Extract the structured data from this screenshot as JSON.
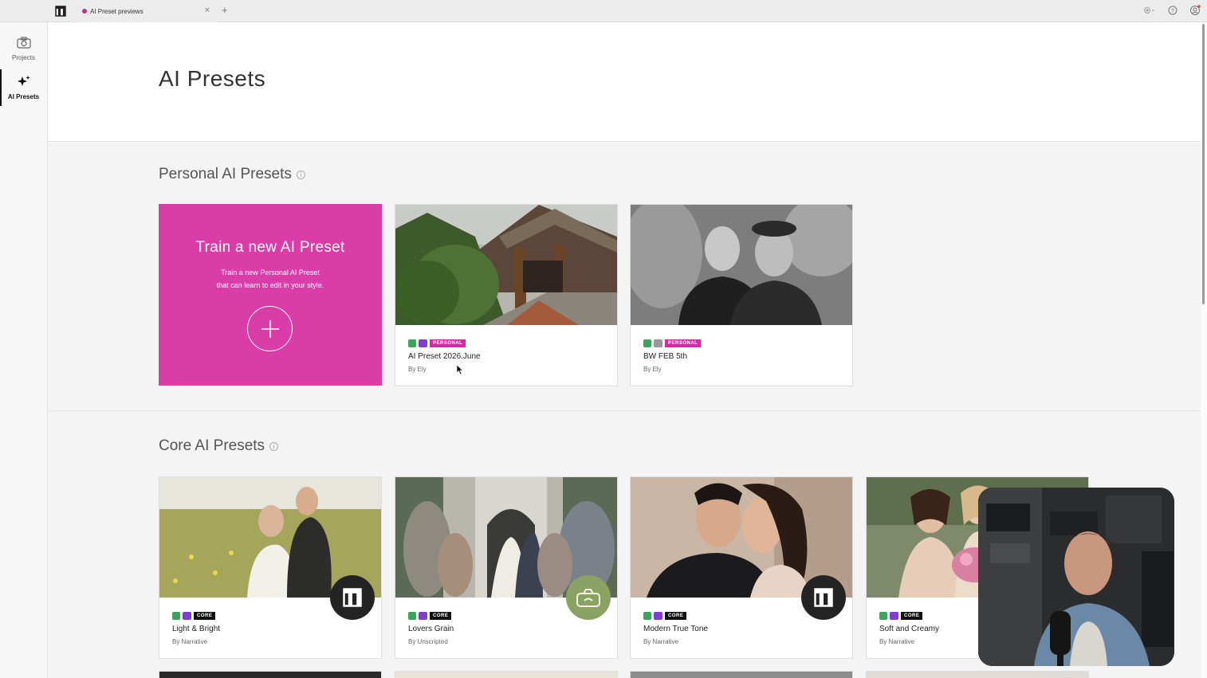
{
  "window": {
    "tab_label": "AI Preset previews",
    "tab_close": "×",
    "tab_add": "+"
  },
  "sidebar": {
    "items": [
      {
        "label": "Projects",
        "icon": "camera-icon"
      },
      {
        "label": "AI Presets",
        "icon": "sparkle-icon"
      }
    ]
  },
  "page": {
    "title": "AI Presets"
  },
  "personal_section": {
    "title": "Personal AI Presets",
    "train_card": {
      "title": "Train a new AI Preset",
      "subtitle_line1": "Train a new Personal AI Preset",
      "subtitle_line2": "that can learn to edit in your style."
    },
    "cards": [
      {
        "name": "AI Preset 2026.June",
        "by": "By Ely",
        "badge": "PERSONAL"
      },
      {
        "name": "BW FEB 5th",
        "by": "By Ely",
        "badge": "PERSONAL"
      }
    ]
  },
  "core_section": {
    "title": "Core AI Presets",
    "cards": [
      {
        "name": "Light & Bright",
        "by": "By Narrative",
        "badge": "CORE",
        "brand_icon": "narrative-logo-icon"
      },
      {
        "name": "Lovers Grain",
        "by": "By Unscripted",
        "badge": "CORE",
        "brand_icon": "unscripted-logo-icon"
      },
      {
        "name": "Modern True Tone",
        "by": "By Narrative",
        "badge": "CORE",
        "brand_icon": "narrative-logo-icon"
      },
      {
        "name": "Soft and Creamy",
        "by": "By Narrative",
        "badge": "CORE"
      }
    ]
  },
  "colors": {
    "accent_pink": "#db3da8",
    "personal_badge": "#d62aa6",
    "core_badge": "#111111"
  }
}
